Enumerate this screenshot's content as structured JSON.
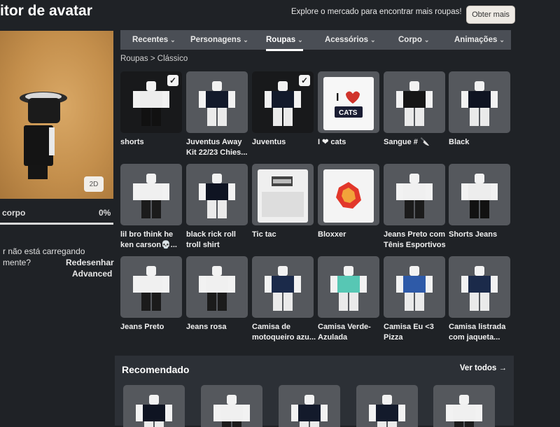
{
  "header": {
    "title": "itor de avatar",
    "promo_text": "Explore o mercado para encontrar mais roupas!",
    "get_more_label": "Obter mais"
  },
  "preview": {
    "toggle_2d_label": "2D",
    "body_label": "corpo",
    "body_percent": "0%"
  },
  "sidebar": {
    "loading_line1": "r não está carregando",
    "loading_line2": "mente?",
    "redraw_link": "Redesenhar",
    "advanced_link": "Advanced"
  },
  "tabs": [
    {
      "label": "Recentes",
      "active": false
    },
    {
      "label": "Personagens",
      "active": false
    },
    {
      "label": "Roupas",
      "active": true
    },
    {
      "label": "Acessórios",
      "active": false
    },
    {
      "label": "Corpo",
      "active": false
    },
    {
      "label": "Animações",
      "active": false
    }
  ],
  "breadcrumb": {
    "root": "Roupas",
    "separator": ">",
    "current": "Clássico"
  },
  "items": [
    {
      "name": "shorts",
      "selected": true,
      "icon": "avatar-shorts-icon"
    },
    {
      "name": "Juventus Away Kit 22/23 Chies...",
      "selected": false,
      "icon": "avatar-jersey-icon"
    },
    {
      "name": "Juventus",
      "selected": true,
      "icon": "avatar-jersey-icon"
    },
    {
      "name": "I ❤ cats",
      "selected": false,
      "icon": "shirt-i-love-cats-icon"
    },
    {
      "name": "Sangue # 🔪",
      "selected": false,
      "icon": "avatar-skeleton-icon"
    },
    {
      "name": "Black",
      "selected": false,
      "icon": "avatar-black-shirt-icon"
    },
    {
      "name": "lil bro think he ken carson💀...",
      "selected": false,
      "icon": "avatar-pants-icon"
    },
    {
      "name": "black rick roll troll shirt",
      "selected": false,
      "icon": "avatar-black-shirt-icon"
    },
    {
      "name": "Tic tac",
      "selected": false,
      "icon": "shirt-template-icon"
    },
    {
      "name": "Bloxxer",
      "selected": false,
      "icon": "shirt-bloxxer-icon"
    },
    {
      "name": "Jeans Preto com Tênis Esportivos",
      "selected": false,
      "icon": "avatar-pants-icon"
    },
    {
      "name": "Shorts Jeans",
      "selected": false,
      "icon": "avatar-shorts-icon"
    },
    {
      "name": "Jeans Preto",
      "selected": false,
      "icon": "avatar-pants-icon"
    },
    {
      "name": "Jeans rosa",
      "selected": false,
      "icon": "avatar-pants-icon"
    },
    {
      "name": "Camisa de motoqueiro azu...",
      "selected": false,
      "icon": "avatar-jacket-icon"
    },
    {
      "name": "Camisa Verde-Azulada",
      "selected": false,
      "icon": "avatar-teal-shirt-icon"
    },
    {
      "name": "Camisa Eu <3 Pizza",
      "selected": false,
      "icon": "avatar-blue-shirt-icon"
    },
    {
      "name": "Camisa listrada com jaqueta...",
      "selected": false,
      "icon": "avatar-jacket-icon"
    }
  ],
  "recommended": {
    "title": "Recomendado",
    "see_all_label": "Ver todos →"
  },
  "colors": {
    "page_bg": "#1f2226",
    "tab_bar_bg": "#4a4e55",
    "tile_bg": "#55585d",
    "selected_tile_bg": "#18191b",
    "preview_bg": "#c48f4c"
  }
}
